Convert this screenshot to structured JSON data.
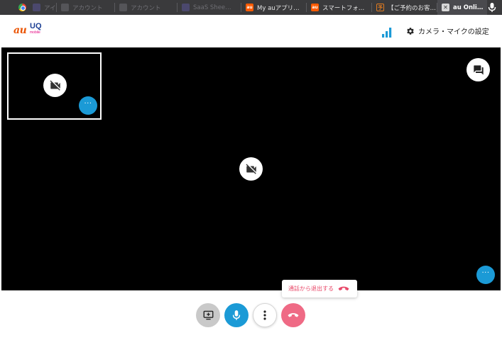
{
  "browser": {
    "tabs": [
      {
        "title": "",
        "icon": "chrome-icon"
      },
      {
        "title": "アイ",
        "icon": "site-icon",
        "dim": true
      },
      {
        "title": "アカウント",
        "icon": "doc-icon",
        "dim": true
      },
      {
        "title": "アカウント",
        "icon": "doc-icon",
        "dim": true
      },
      {
        "title": "SaaS Shee…",
        "icon": "site-icon",
        "dim": true
      },
      {
        "title": "My auアプリ…",
        "icon": "au-icon"
      },
      {
        "title": "スマートフォ…",
        "icon": "au-icon"
      },
      {
        "title": "【ご予約のお客…",
        "icon": "reserve-icon"
      },
      {
        "title": "au Onli…",
        "icon": "close-icon",
        "active": true
      }
    ]
  },
  "header": {
    "logo_au": "au",
    "logo_uq": "UQ",
    "logo_mobile": "mobile",
    "settings_label": "カメラ・マイクの設定"
  },
  "leave_call": {
    "label": "通話から退出する"
  },
  "colors": {
    "accent_blue": "#1b9ad6",
    "hangup_pink": "#ef6a85",
    "brand_au": "#eb5505",
    "brand_uq": "#1c3f94",
    "stage": "#000000"
  }
}
